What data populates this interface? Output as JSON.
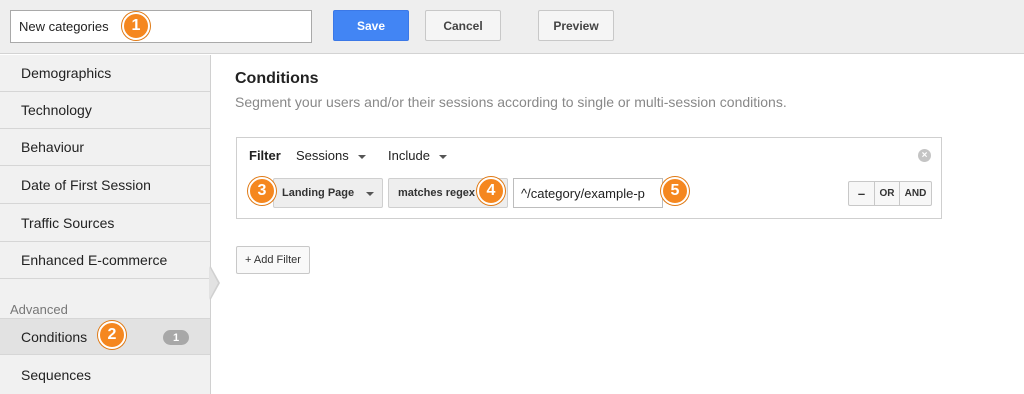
{
  "header": {
    "segment_name_value": "New categories",
    "save_label": "Save",
    "cancel_label": "Cancel",
    "preview_label": "Preview"
  },
  "sidebar": {
    "items": [
      {
        "label": "Demographics"
      },
      {
        "label": "Technology"
      },
      {
        "label": "Behaviour"
      },
      {
        "label": "Date of First Session"
      },
      {
        "label": "Traffic Sources"
      },
      {
        "label": "Enhanced E-commerce"
      }
    ],
    "advanced_heading": "Advanced",
    "advanced_items": [
      {
        "label": "Conditions",
        "count": "1",
        "active": true
      },
      {
        "label": "Sequences"
      }
    ]
  },
  "main": {
    "title": "Conditions",
    "description": "Segment your users and/or their sessions according to single or multi-session conditions.",
    "filter": {
      "label": "Filter",
      "scope": "Sessions",
      "mode": "Include",
      "dimension": "Landing Page",
      "operator": "matches regex",
      "value": "^/category/example-p",
      "logic": {
        "minus": "–",
        "or": "OR",
        "and": "AND"
      }
    },
    "add_filter_label": "+ Add Filter"
  },
  "markers": [
    "1",
    "2",
    "3",
    "4",
    "5"
  ],
  "colors": {
    "accent_blue": "#4285f4",
    "marker_orange": "#f5871f",
    "sidebar_bg": "#f1f1f1",
    "topbar_bg": "#eeeeee"
  }
}
